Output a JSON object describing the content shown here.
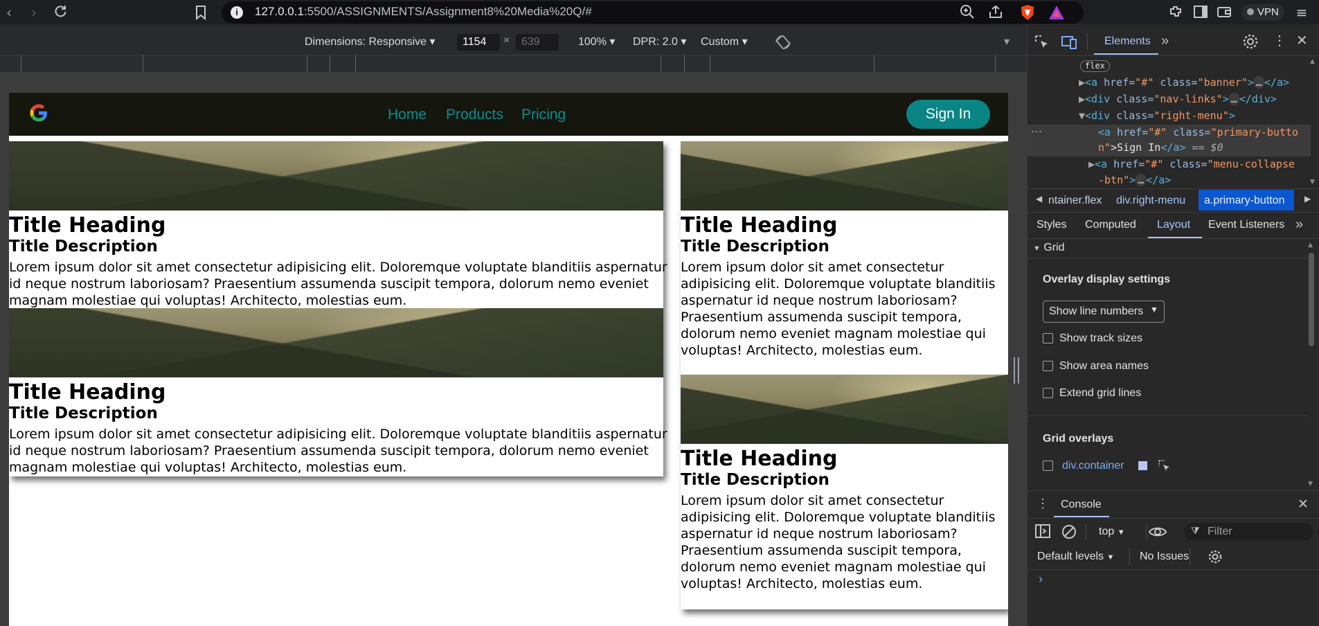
{
  "browser": {
    "url": "127.0.0.1:5500/ASSIGNMENTS/Assignment8%20Media%20Q/#",
    "url_host": "127.0.0.1",
    "url_path": ":5500/ASSIGNMENTS/Assignment8%20Media%20Q/#",
    "vpn_label": "VPN"
  },
  "device_toolbar": {
    "dimensions": "Dimensions: Responsive",
    "width": "1154",
    "times": "×",
    "height": "639",
    "zoom": "100%",
    "dpr": "DPR: 2.0",
    "throttle": "Custom"
  },
  "site": {
    "nav_links": [
      "Home",
      "Products",
      "Pricing"
    ],
    "sign_in": "Sign In",
    "cards": [
      {
        "title": "Title Heading",
        "desc": "Title Description",
        "body": "Lorem ipsum dolor sit amet consectetur adipisicing elit. Doloremque voluptate blanditiis aspernatur id neque nostrum laboriosam? Praesentium assumenda suscipit tempora, dolorum nemo eveniet magnam molestiae qui voluptas! Architecto, molestias eum."
      },
      {
        "title": "Title Heading",
        "desc": "Title Description",
        "body": "Lorem ipsum dolor sit amet consectetur adipisicing elit. Doloremque voluptate blanditiis aspernatur id neque nostrum laboriosam? Praesentium assumenda suscipit tempora, dolorum nemo eveniet magnam molestiae qui voluptas! Architecto, molestias eum."
      },
      {
        "title": "Title Heading",
        "desc": "Title Description",
        "body": "Lorem ipsum dolor sit amet consectetur adipisicing elit. Doloremque voluptate blanditiis aspernatur id neque nostrum laboriosam? Praesentium assumenda suscipit tempora, dolorum nemo eveniet magnam molestiae qui voluptas! Architecto, molestias eum."
      },
      {
        "title": "Title Heading",
        "desc": "Title Description",
        "body": "Lorem ipsum dolor sit amet consectetur adipisicing elit. Doloremque voluptate blanditiis aspernatur id neque nostrum laboriosam? Praesentium assumenda suscipit tempora, dolorum nemo eveniet magnam molestiae qui voluptas! Architecto, molestias eum."
      }
    ]
  },
  "devtools": {
    "tab_elements": "Elements",
    "flex_badge": "flex",
    "dom": {
      "banner_tag": "<a ",
      "banner_attr": "href=",
      "banner_href": "\"#\"",
      "banner_class_attr": " class=",
      "banner_class": "\"banner\"",
      "banner_end": "</a>",
      "navlinks_tag": "<div ",
      "navlinks_attr": "class=",
      "navlinks_class": "\"nav-links\"",
      "navlinks_end": "</div>",
      "right_tag": "<div ",
      "right_attr": "class=",
      "right_class": "\"right-menu\"",
      "right_close": ">",
      "pb_tag": "<a ",
      "pb_attr": "href=",
      "pb_href": "\"#\"",
      "pb_class_attr": " class=",
      "pb_class1": "\"primary-butto",
      "pb_class2": "n\"",
      "pb_text": ">Sign In",
      "pb_end": "</a>",
      "pb_eq": " == $0",
      "mc_tag": "<a ",
      "mc_attr": "href=",
      "mc_href": "\"#\"",
      "mc_class_attr": " class=",
      "mc_class1": "\"menu-collapse",
      "mc_class2": "-btn\"",
      "mc_end": "</a>",
      "ellipsis": "…"
    },
    "breadcrumbs": [
      "ntainer.flex",
      "div.right-menu",
      "a.primary-button"
    ],
    "panel_tabs": [
      "Styles",
      "Computed",
      "Layout",
      "Event Listeners"
    ],
    "grid_section": "Grid",
    "overlay_settings": "Overlay display settings",
    "line_numbers_select": "Show line numbers",
    "checkboxes": [
      "Show track sizes",
      "Show area names",
      "Extend grid lines"
    ],
    "grid_overlays": "Grid overlays",
    "overlay_item": "div.container",
    "overlay_color": "#b7c7f5",
    "console_tab": "Console",
    "console_context": "top",
    "filter_placeholder": "Filter",
    "levels": "Default levels",
    "issues": "No Issues",
    "prompt": "›"
  },
  "colors": {
    "accent_teal": "#0a8484",
    "nav_link": "#0a8e8e",
    "devtools_blue": "#7cacf8"
  }
}
